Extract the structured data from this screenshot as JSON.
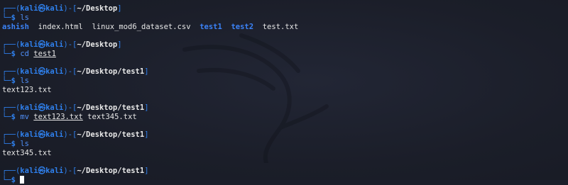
{
  "prompt": {
    "open_corner": "┌──(",
    "user": "kali",
    "at_icon": "㉿",
    "host": "kali",
    "mid": ")-[",
    "close": "]",
    "close_corner": "└─",
    "dollar": "$"
  },
  "blocks": [
    {
      "path": "~/Desktop",
      "command": "ls",
      "args": [],
      "output": [
        {
          "text": "ashish",
          "type": "dir"
        },
        {
          "text": "index.html",
          "type": "file"
        },
        {
          "text": "linux_mod6_dataset.csv",
          "type": "file"
        },
        {
          "text": "test1",
          "type": "dir"
        },
        {
          "text": "test2",
          "type": "dir"
        },
        {
          "text": "test.txt",
          "type": "file"
        }
      ]
    },
    {
      "path": "~/Desktop",
      "command": "cd",
      "args": [
        "test1"
      ],
      "output": []
    },
    {
      "path": "~/Desktop/test1",
      "command": "ls",
      "args": [],
      "output": [
        {
          "text": "text123.txt",
          "type": "file"
        }
      ]
    },
    {
      "path": "~/Desktop/test1",
      "command": "mv",
      "args": [
        "text123.txt",
        "text345.txt"
      ],
      "output": []
    },
    {
      "path": "~/Desktop/test1",
      "command": "ls",
      "args": [],
      "output": [
        {
          "text": "text345.txt",
          "type": "file"
        }
      ]
    },
    {
      "path": "~/Desktop/test1",
      "command": "",
      "args": [],
      "output": [],
      "cursor": true
    }
  ]
}
